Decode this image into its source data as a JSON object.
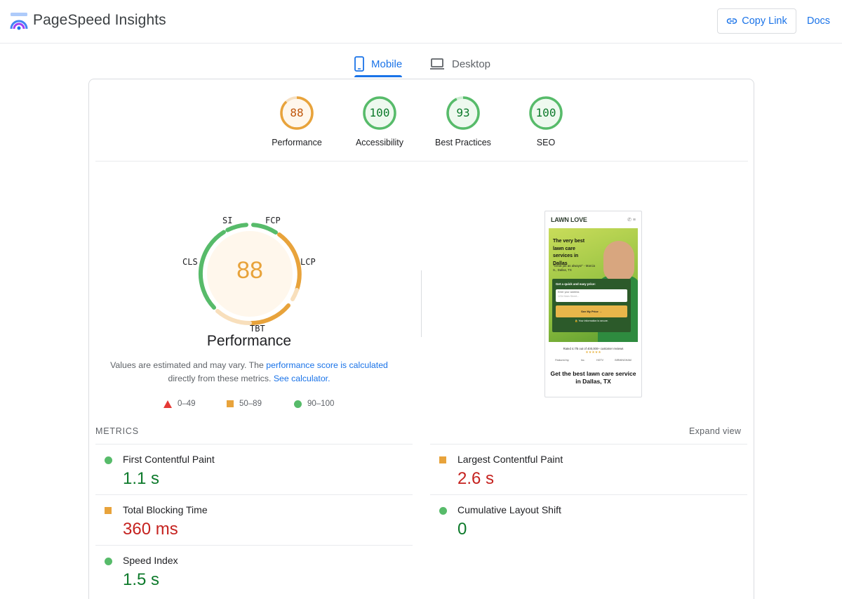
{
  "header": {
    "title": "PageSpeed Insights",
    "copy_link": "Copy Link",
    "docs": "Docs",
    "logo_icon": "pagespeed-logo-icon",
    "link_icon": "link-icon"
  },
  "tabs": [
    {
      "label": "Mobile",
      "icon": "phone-icon",
      "selected": true
    },
    {
      "label": "Desktop",
      "icon": "laptop-icon",
      "selected": false
    }
  ],
  "categories": [
    {
      "label": "Performance",
      "score": "88",
      "status": "average"
    },
    {
      "label": "Accessibility",
      "score": "100",
      "status": "pass"
    },
    {
      "label": "Best Practices",
      "score": "93",
      "status": "pass"
    },
    {
      "label": "SEO",
      "score": "100",
      "status": "pass"
    }
  ],
  "performance": {
    "score": "88",
    "title": "Performance",
    "segments": {
      "si": "SI",
      "fcp": "FCP",
      "lcp": "LCP",
      "tbt": "TBT",
      "cls": "CLS"
    },
    "note_before": "Values are estimated and may vary. The ",
    "note_link": "performance score is calculated",
    "note_middle": " directly from these metrics. ",
    "note_link2": "See calculator."
  },
  "legend": [
    {
      "range": "0–49",
      "shape": "triangle",
      "color": "#e53935"
    },
    {
      "range": "50–89",
      "shape": "square",
      "color": "#e8a33b"
    },
    {
      "range": "90–100",
      "shape": "circle",
      "color": "#57bb6a"
    }
  ],
  "screenshot": {
    "brand": "LAWN LOVE",
    "headline": "The very best lawn care services in Dallas",
    "quote": "\"Great job as always!\" - Marcia S., Dallas, TX",
    "form_title": "Get a quick and easy price:",
    "input_label": "Enter your address",
    "input_placeholder": "1234 Main Street...",
    "button": "See My Price →",
    "secure": "🔒 Your information is secure.",
    "rated": "Rated 4.7/5 out of 400,000+ customer reviews",
    "stars": "★★★★★",
    "logos": [
      "Featured by:",
      "Inc.",
      "HGTV",
      "BIRMINGHAM"
    ],
    "footer": "Get the best lawn care service in Dallas, TX"
  },
  "metrics": {
    "title": "METRICS",
    "expand": "Expand view",
    "items": [
      {
        "name": "First Contentful Paint",
        "value": "1.1 s",
        "status": "good"
      },
      {
        "name": "Largest Contentful Paint",
        "value": "2.6 s",
        "status": "average"
      },
      {
        "name": "Total Blocking Time",
        "value": "360 ms",
        "status": "average"
      },
      {
        "name": "Cumulative Layout Shift",
        "value": "0",
        "status": "good"
      },
      {
        "name": "Speed Index",
        "value": "1.5 s",
        "status": "good"
      }
    ]
  },
  "colors": {
    "accent": "#1a73e8",
    "pass": "#57bb6a",
    "average": "#e8a33b",
    "fail": "#e53935"
  }
}
